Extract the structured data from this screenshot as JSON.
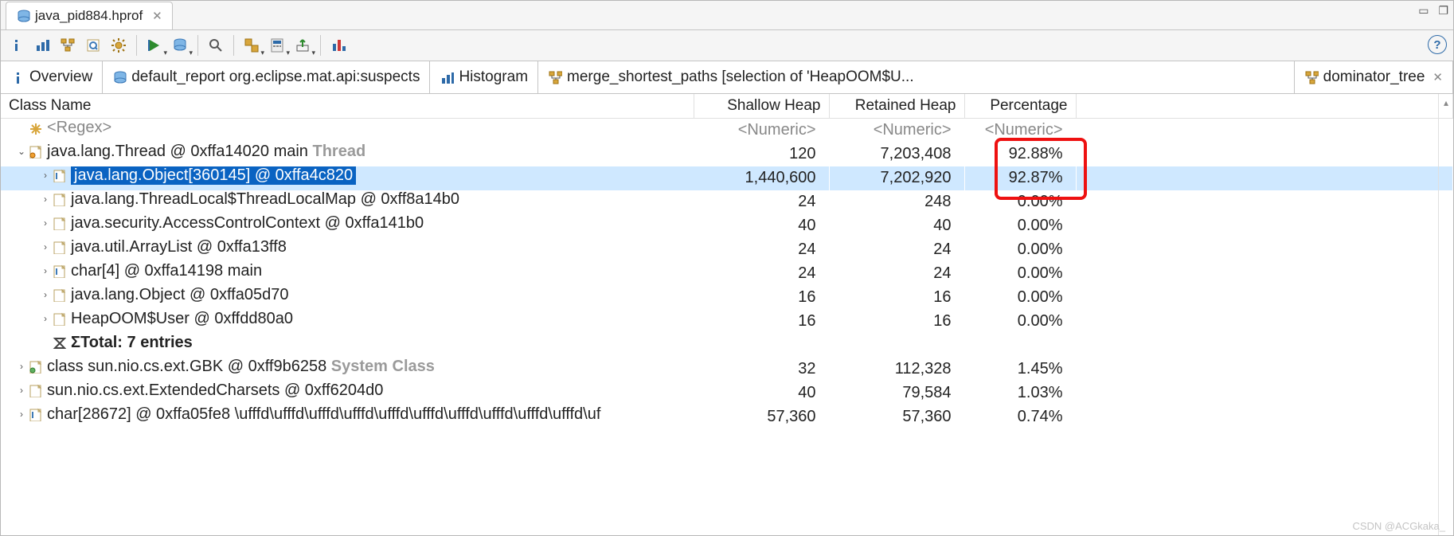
{
  "file_tab": {
    "title": "java_pid884.hprof"
  },
  "view_tabs": [
    {
      "id": "overview",
      "label": "Overview",
      "icon": "info"
    },
    {
      "id": "default",
      "label": "default_report  org.eclipse.mat.api:suspects",
      "icon": "db"
    },
    {
      "id": "histogram",
      "label": "Histogram",
      "icon": "bars"
    },
    {
      "id": "merge",
      "label": "merge_shortest_paths  [selection of 'HeapOOM$U...",
      "icon": "tree"
    },
    {
      "id": "dominator",
      "label": "dominator_tree",
      "icon": "tree",
      "closable": true
    }
  ],
  "columns": {
    "name": "Class Name",
    "shallow": "Shallow Heap",
    "retained": "Retained Heap",
    "pct": "Percentage"
  },
  "filter_row": {
    "name": "<Regex>",
    "shallow": "<Numeric>",
    "retained": "<Numeric>",
    "pct": "<Numeric>"
  },
  "rows": [
    {
      "depth": 0,
      "exp": "open",
      "icon": "obj-o",
      "label": "java.lang.Thread @ 0xffa14020  main",
      "suffix": "Thread",
      "shallow": "120",
      "retained": "7,203,408",
      "pct": "92.88%"
    },
    {
      "depth": 1,
      "exp": "closed",
      "icon": "obj-i",
      "label": "java.lang.Object[360145] @ 0xffa4c820",
      "shallow": "1,440,600",
      "retained": "7,202,920",
      "pct": "92.87%",
      "selected": true
    },
    {
      "depth": 1,
      "exp": "closed",
      "icon": "obj",
      "label": "java.lang.ThreadLocal$ThreadLocalMap @ 0xff8a14b0",
      "shallow": "24",
      "retained": "248",
      "pct": "0.00%"
    },
    {
      "depth": 1,
      "exp": "closed",
      "icon": "obj",
      "label": "java.security.AccessControlContext @ 0xffa141b0",
      "shallow": "40",
      "retained": "40",
      "pct": "0.00%"
    },
    {
      "depth": 1,
      "exp": "closed",
      "icon": "obj",
      "label": "java.util.ArrayList @ 0xffa13ff8",
      "shallow": "24",
      "retained": "24",
      "pct": "0.00%"
    },
    {
      "depth": 1,
      "exp": "closed",
      "icon": "obj-i",
      "label": "char[4] @ 0xffa14198  main",
      "shallow": "24",
      "retained": "24",
      "pct": "0.00%"
    },
    {
      "depth": 1,
      "exp": "closed",
      "icon": "obj",
      "label": "java.lang.Object @ 0xffa05d70",
      "shallow": "16",
      "retained": "16",
      "pct": "0.00%"
    },
    {
      "depth": 1,
      "exp": "closed",
      "icon": "obj",
      "label": "HeapOOM$User @ 0xffdd80a0",
      "shallow": "16",
      "retained": "16",
      "pct": "0.00%"
    },
    {
      "depth": 1,
      "exp": "none",
      "icon": "sum",
      "label": "Total: 7 entries",
      "totals": true
    },
    {
      "depth": 0,
      "exp": "closed",
      "icon": "obj-c",
      "label": "class sun.nio.cs.ext.GBK @ 0xff9b6258",
      "suffix": "System Class",
      "shallow": "32",
      "retained": "112,328",
      "pct": "1.45%"
    },
    {
      "depth": 0,
      "exp": "closed",
      "icon": "obj",
      "label": "sun.nio.cs.ext.ExtendedCharsets @ 0xff6204d0",
      "shallow": "40",
      "retained": "79,584",
      "pct": "1.03%"
    },
    {
      "depth": 0,
      "exp": "closed",
      "icon": "obj-i",
      "label": "char[28672] @ 0xffa05fe8  \\ufffd\\ufffd\\ufffd\\ufffd\\ufffd\\ufffd\\ufffd\\ufffd\\ufffd\\ufffd\\uf",
      "shallow": "57,360",
      "retained": "57,360",
      "pct": "0.74%"
    }
  ],
  "watermark": "CSDN @ACGkaka_"
}
